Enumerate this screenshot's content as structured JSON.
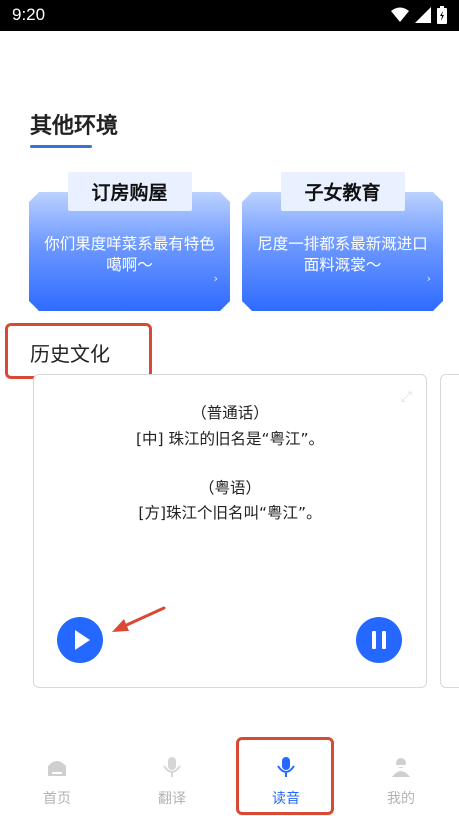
{
  "status_bar": {
    "time": "9:20"
  },
  "section": {
    "title": "其他环境"
  },
  "env_cards": [
    {
      "title": "订房购屋",
      "desc": "你们果度咩菜系最有特色噶啊～"
    },
    {
      "title": "子女教育",
      "desc": "尼度一排都系最新溉进口面料溉裳～"
    }
  ],
  "culture": {
    "label": "历史文化"
  },
  "dialog": {
    "mandarin_heading": "（普通话）",
    "mandarin_line": "[中] 珠江的旧名是“粤江”。",
    "cantonese_heading": "（粤语）",
    "cantonese_line": "[方]珠江个旧名叫“粤江”。"
  },
  "tabs": [
    {
      "label": "首页",
      "icon": "home-icon"
    },
    {
      "label": "翻译",
      "icon": "mic-icon"
    },
    {
      "label": "读音",
      "icon": "mic-icon",
      "active": true
    },
    {
      "label": "我的",
      "icon": "user-icon"
    }
  ],
  "colors": {
    "accent": "#2468ff",
    "annotation": "#d94a36",
    "inactive": "#b3b3b3"
  }
}
